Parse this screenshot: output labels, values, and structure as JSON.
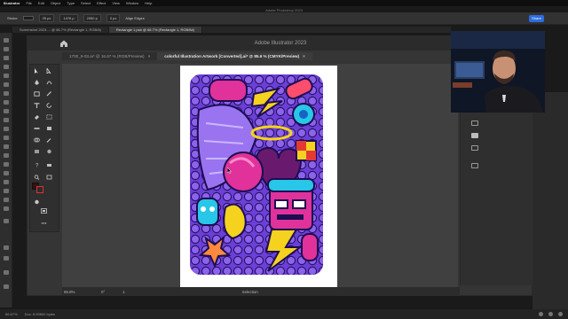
{
  "menubar": {
    "app": "Illustrator",
    "items": [
      "File",
      "Edit",
      "Object",
      "Type",
      "Select",
      "Effect",
      "View",
      "Window",
      "Help"
    ]
  },
  "photoshop": {
    "app_title": "Adobe Photoshop 2023",
    "options": {
      "stroke_label": "Stroke",
      "px_value": "25 px",
      "w_value": "1476 p",
      "h_value": "2050 p",
      "radius_value": "0 px",
      "align_edges_label": "Align Edges"
    },
    "share_label": "Share",
    "doc_tabs": [
      {
        "label": "Screenshot 2023-... @ 66.7% (Rectangle 1, RGB/8)",
        "active": false
      },
      {
        "label": "Rectangle 1.psb @ 66.7% (Rectangle 1, RGB/8#)",
        "active": true
      }
    ],
    "status": {
      "zoom": "66.67%",
      "doc_size": "Doc: 8.99M/0 bytes"
    }
  },
  "illustrator": {
    "title": "Adobe Illustrator 2023",
    "tabs": [
      {
        "label": "1700_9-03.ai* @ 16.67 % (RGB/Preview)",
        "active": false
      },
      {
        "label": "colorful Illustration Artwork [Converted].ai* @ 85.6 % (CMYK/Preview)",
        "active": true
      }
    ],
    "close_glyph": "×",
    "bottombar": {
      "zoom": "85.8%",
      "rotation": "0°",
      "artboard_number": "1",
      "status_label": "Selection"
    }
  },
  "colors": {
    "accent_blue": "#2d6de0",
    "artwork_purple": "#6b3fd8",
    "artwork_pink": "#e0329a",
    "artwork_yellow": "#f5d21e",
    "artwork_cyan": "#28c6e8",
    "artwork_red": "#e53935"
  }
}
